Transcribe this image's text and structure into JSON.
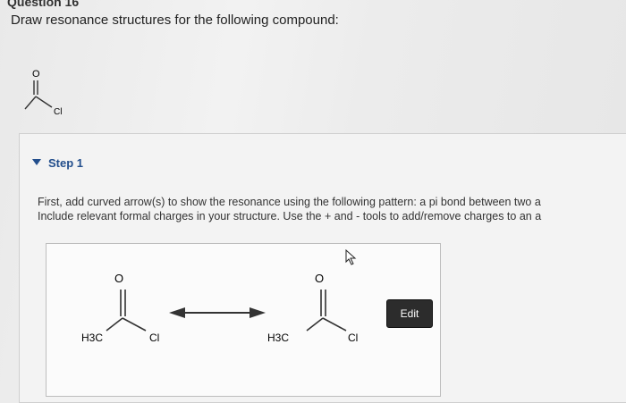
{
  "question": {
    "title": "Question 16",
    "prompt": "Draw resonance structures for the following compound:"
  },
  "compound": {
    "atom_o": "O",
    "atom_cl": "Cl"
  },
  "step": {
    "label": "Step 1",
    "instruction_line1": "First, add curved arrow(s) to show the resonance using the following pattern: a pi bond between two a",
    "instruction_line2": "Include relevant formal charges in your structure. Use the + and - tools to add/remove charges to an a"
  },
  "structures": {
    "left": {
      "o": "O",
      "h3c": "H3C",
      "cl": "Cl"
    },
    "right": {
      "o": "O",
      "h3c": "H3C",
      "cl": "Cl"
    }
  },
  "edit_button": {
    "label": "Edit"
  }
}
